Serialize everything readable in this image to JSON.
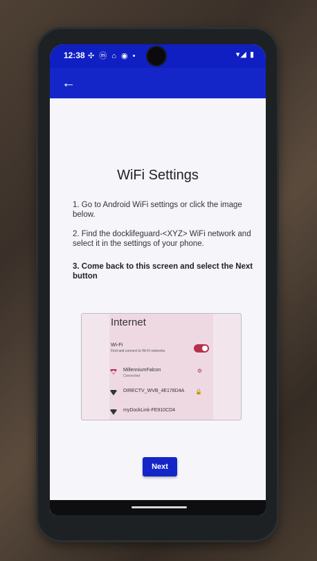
{
  "status_bar": {
    "time": "12:38",
    "left_icons": "✣ ⓜ ⌂ ◉ •",
    "right_icons": "▾◢ ▮"
  },
  "app_bar": {
    "back_icon": "←"
  },
  "page": {
    "title": "WiFi Settings",
    "step1": "1. Go to Android WiFi settings or click the image below.",
    "step2": "2. Find the docklifeguard-<XYZ> WiFi network and select it in the settings of your phone.",
    "step3": "3. Come back to this screen and select the Next button"
  },
  "wifi_image": {
    "title": "Internet",
    "wifi_label": "Wi-Fi",
    "wifi_sub": "Find and connect to Wi-Fi networks",
    "toggle_on": true,
    "networks": [
      {
        "name": "MillenniumFalcon",
        "sub": "Connected",
        "trailing": "⚙",
        "accent": "#b5314b"
      },
      {
        "name": "DIRECTV_WVB_4E178D4A",
        "sub": "",
        "trailing": "🔒",
        "accent": "#333333"
      },
      {
        "name": "myDockLink-FE910CD4",
        "sub": "",
        "trailing": "",
        "accent": "#333333"
      }
    ]
  },
  "actions": {
    "next_label": "Next"
  },
  "colors": {
    "primary": "#1426c8",
    "toggle": "#b5314b"
  }
}
